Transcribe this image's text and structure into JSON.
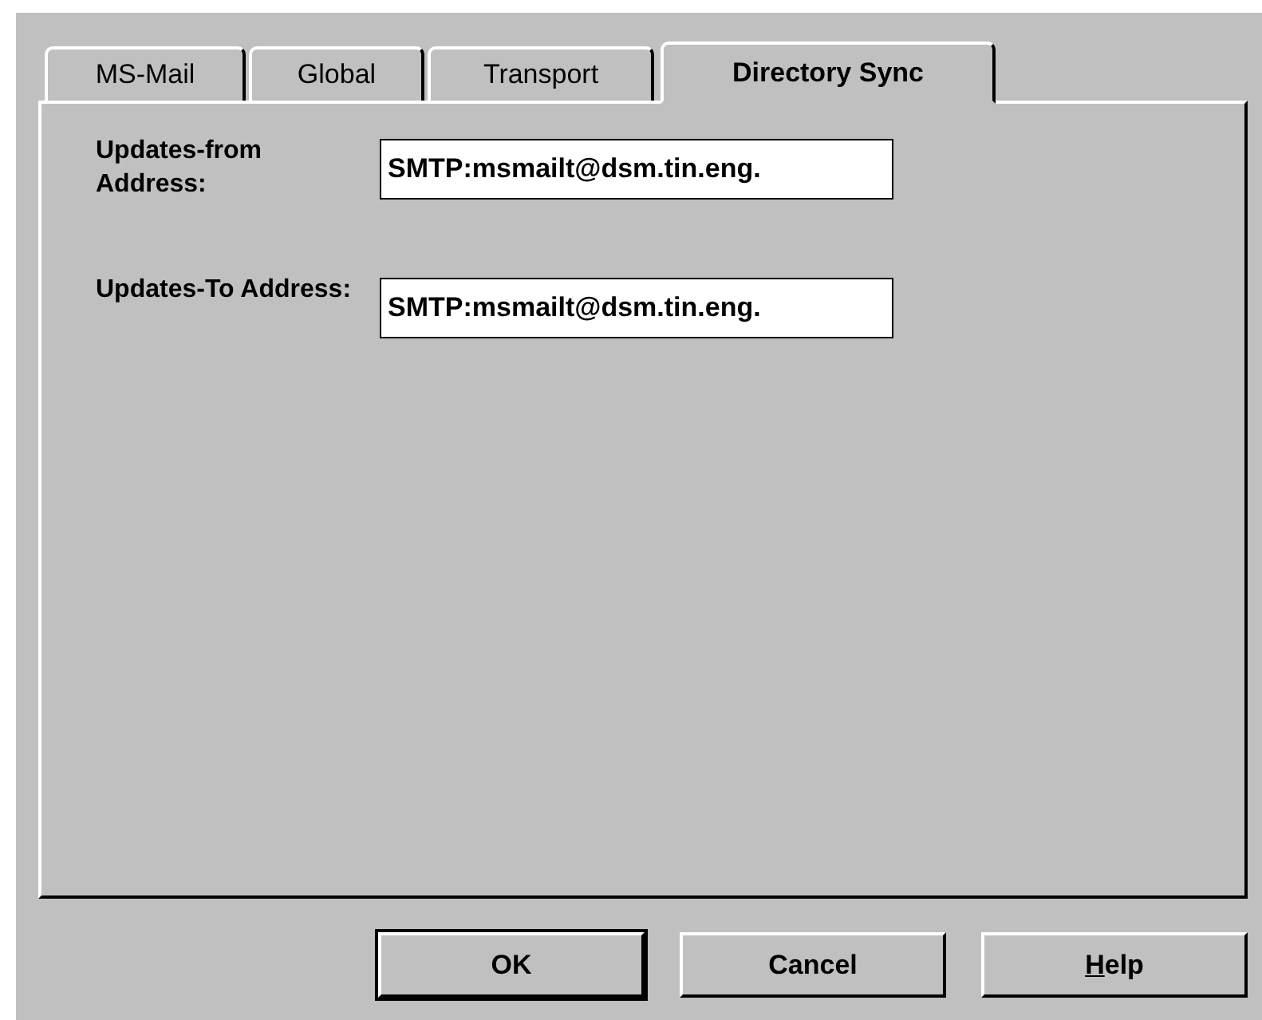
{
  "tabs": [
    {
      "label": "MS-Mail",
      "selected": false
    },
    {
      "label": "Global",
      "selected": false
    },
    {
      "label": "Transport",
      "selected": false
    },
    {
      "label": "Directory Sync",
      "selected": true
    }
  ],
  "fields": [
    {
      "label": "Updates-from Address:",
      "value": "SMTP:msmailt@dsm.tin.eng."
    },
    {
      "label": "Updates-To Address:",
      "value": "SMTP:msmailt@dsm.tin.eng."
    }
  ],
  "buttons": [
    {
      "label": "OK",
      "default": true,
      "mnemonic_underlined": false
    },
    {
      "label": "Cancel",
      "default": false,
      "mnemonic_underlined": false
    },
    {
      "label": "Help",
      "default": false,
      "mnemonic_underlined": true
    }
  ]
}
